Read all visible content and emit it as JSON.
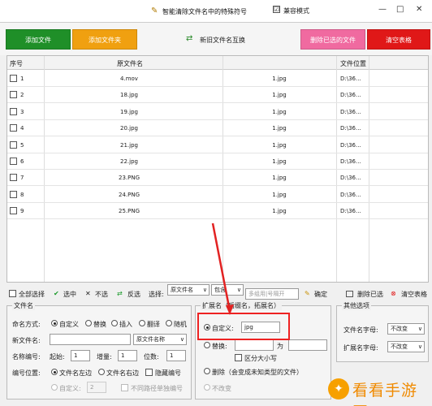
{
  "window": {
    "title": "智能清除文件名中的特殊符号",
    "compat_mode": "兼容模式",
    "compat_checked": "☑",
    "controls": [
      "—",
      "□",
      "✕"
    ]
  },
  "toolbar": {
    "add_file": "添加文件",
    "add_folder": "添加文件夹",
    "swap": "新旧文件名互换",
    "delete_selected": "删除已选的文件",
    "clear_table": "清空表格"
  },
  "colors": {
    "add_file": "#1f8f28",
    "add_folder": "#f0a010",
    "delete_selected": "#f06aa0",
    "clear_table": "#e01818",
    "highlight": "#e22222",
    "watermark": "#f08a00"
  },
  "table": {
    "headers": [
      "序号",
      "原文件名",
      "",
      "文件位置"
    ],
    "rows": [
      {
        "num": "1",
        "orig": "4.mov",
        "new": "1.jpg",
        "loc": "D:\\36..."
      },
      {
        "num": "2",
        "orig": "18.jpg",
        "new": "1.jpg",
        "loc": "D:\\36..."
      },
      {
        "num": "3",
        "orig": "19.jpg",
        "new": "1.jpg",
        "loc": "D:\\36..."
      },
      {
        "num": "4",
        "orig": "20.jpg",
        "new": "1.jpg",
        "loc": "D:\\36..."
      },
      {
        "num": "5",
        "orig": "21.jpg",
        "new": "1.jpg",
        "loc": "D:\\36..."
      },
      {
        "num": "6",
        "orig": "22.jpg",
        "new": "1.jpg",
        "loc": "D:\\36..."
      },
      {
        "num": "7",
        "orig": "23.PNG",
        "new": "1.jpg",
        "loc": "D:\\36..."
      },
      {
        "num": "8",
        "orig": "24.PNG",
        "new": "1.jpg",
        "loc": "D:\\36..."
      },
      {
        "num": "9",
        "orig": "25.PNG",
        "new": "1.jpg",
        "loc": "D:\\36..."
      }
    ]
  },
  "actions": {
    "select_all": "全部选择",
    "select": "选中",
    "deselect": "不选",
    "invert": "反选",
    "choose_label": "选择:",
    "choose_value": "原文件名",
    "match_value": "包含",
    "match_placeholder": "多组用|号隔开",
    "confirm": "确定",
    "delete_selected": "删除已选",
    "clear_table": "清空表格"
  },
  "filename_panel": {
    "title": "文件名",
    "naming_label": "命名方式:",
    "options": [
      "自定义",
      "替换",
      "插入",
      "翻译",
      "随机"
    ],
    "new_name_label": "新文件名:",
    "new_name_select": "原文件名称",
    "numbering_label": "名称编号:",
    "start_label": "起始:",
    "start_value": "1",
    "step_label": "增量:",
    "step_value": "1",
    "digits_label": "位数:",
    "digits_value": "1",
    "position_label": "编号位置:",
    "pos_left": "文件名左边",
    "pos_right": "文件名右边",
    "hide_number": "隐藏编号",
    "custom_label": "自定义:",
    "custom_value": "2",
    "separate_numbering": "不同路径单独编号"
  },
  "ext_panel": {
    "title": "扩展名（后缀名，拓展名）",
    "custom_label": "自定义:",
    "custom_value": "jpg",
    "replace_label": "替换:",
    "to_label": "为",
    "case_sensitive": "区分大小写",
    "delete_label": "删除（会变成未知类型的文件）",
    "unchanged": "不改变"
  },
  "other_panel": {
    "title": "其他选项",
    "filename_case_label": "文件名字母:",
    "filename_case_value": "不改变",
    "ext_case_label": "扩展名字母:",
    "ext_case_value": "不改变"
  },
  "watermark": {
    "text": "看看手游网"
  }
}
